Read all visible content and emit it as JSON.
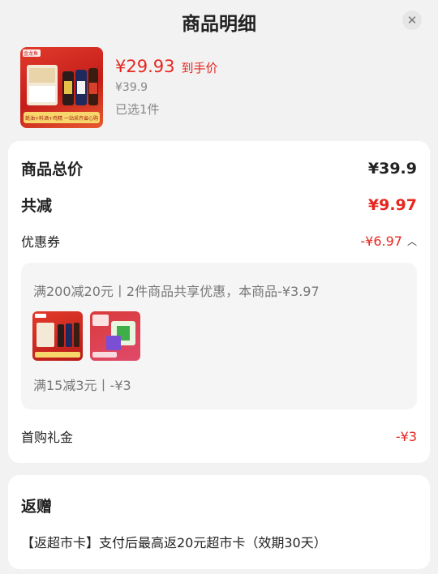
{
  "header": {
    "title": "商品明细",
    "close_icon": "close-icon"
  },
  "product": {
    "price": "¥29.93",
    "price_tag": "到手价",
    "original_price": "¥39.9",
    "selected": "已选1件",
    "thumb_logo_text": "金龙鱼",
    "thumb_footer_text": "蚝油+料酒+鸡精 一站采齐省心购"
  },
  "summary": {
    "total_label": "商品总价",
    "total_value": "¥39.9",
    "reduce_label": "共减",
    "reduce_value": "¥9.97",
    "coupon_label": "优惠券",
    "coupon_value": "-¥6.97",
    "coupon_chevron": "chevron-up-icon"
  },
  "coupons": {
    "line1": "满200减20元丨2件商品共享优惠，本商品-¥3.97",
    "line2": "满15减3元丨-¥3"
  },
  "first_purchase": {
    "label": "首购礼金",
    "value": "-¥3"
  },
  "gift": {
    "title": "返赠",
    "text": "【返超市卡】支付后最高返20元超市卡（效期30天）"
  },
  "colors": {
    "accent": "#e6261f",
    "background": "#f2f2f2",
    "card": "#ffffff"
  }
}
